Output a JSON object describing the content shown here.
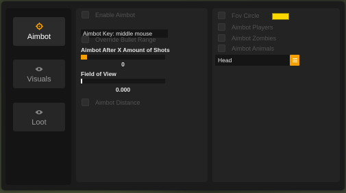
{
  "sidebar": {
    "items": [
      {
        "label": "Aimbot",
        "icon": "crosshair-icon",
        "active": true
      },
      {
        "label": "Visuals",
        "icon": "eye-icon",
        "active": false
      },
      {
        "label": "Loot",
        "icon": "eye-icon",
        "active": false
      }
    ]
  },
  "left_panel": {
    "enable_aimbot": "Enable Aimbot",
    "aimbot_key": "Aimbot Key: middle mouse",
    "override_bullet_range": "Override Bullet Range",
    "shots_label": "Aimbot After X Amount of Shots",
    "shots_value": "0",
    "fov_label": "Field of View",
    "fov_value": "0.000",
    "aimbot_distance": "Aimbot Distance"
  },
  "right_panel": {
    "fov_circle": "Fov Circle",
    "fov_circle_color": "#ffd700",
    "aimbot_players": "Aimbot Players",
    "aimbot_zombies": "Aimbot Zombies",
    "aimbot_animals": "Aimbot Animals",
    "target_bone": "Head"
  },
  "colors": {
    "accent": "#f5a000",
    "panel": "#232323",
    "window": "#1b1b1b"
  }
}
